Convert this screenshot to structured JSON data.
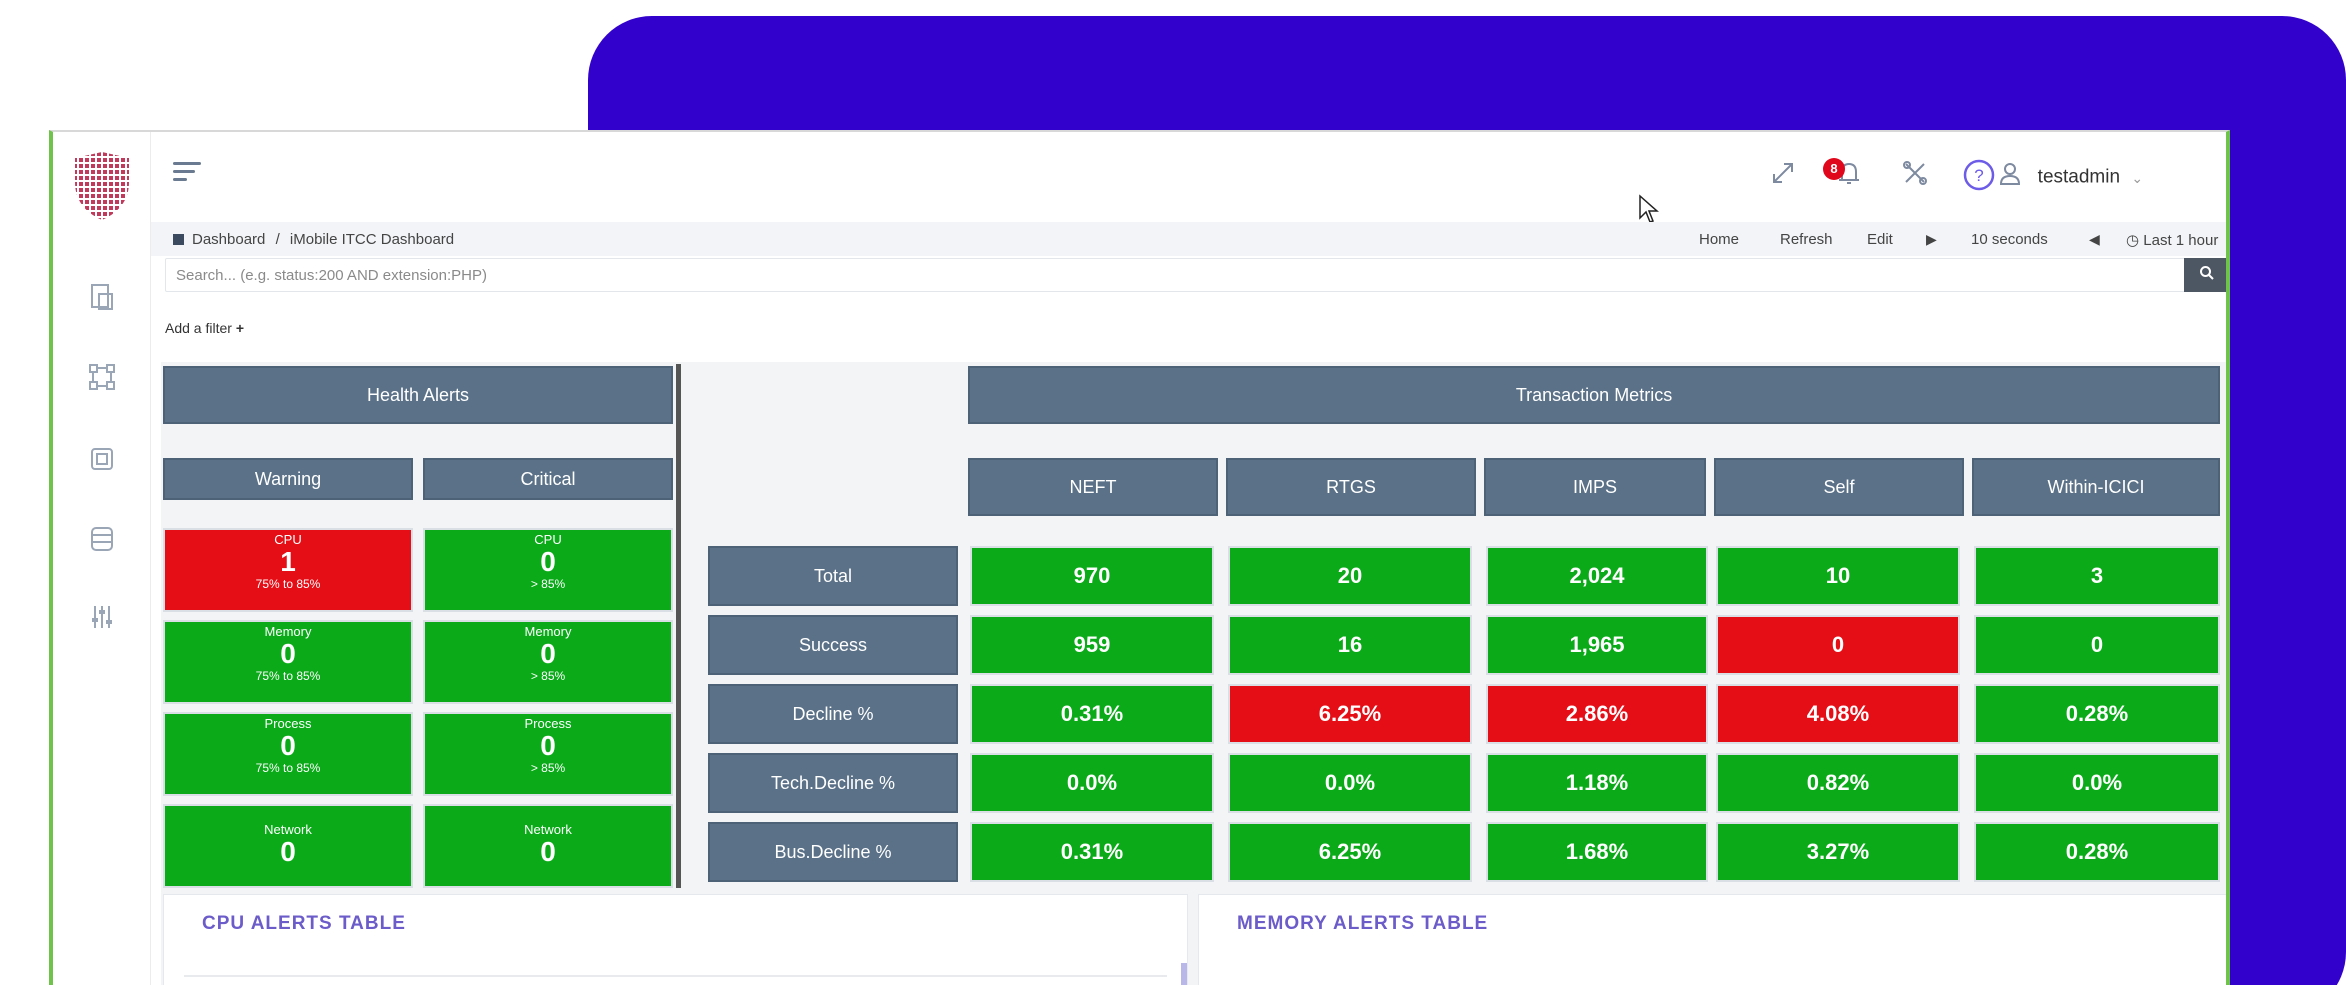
{
  "header": {
    "notification_count": "8",
    "username": "testadmin"
  },
  "toolbar": {
    "breadcrumb_root": "Dashboard",
    "breadcrumb_sep": "/",
    "breadcrumb_current": "iMobile ITCC Dashboard",
    "home": "Home",
    "refresh": "Refresh",
    "edit": "Edit",
    "interval": "10 seconds",
    "time_range": "Last 1 hour"
  },
  "search": {
    "placeholder": "Search... (e.g. status:200 AND extension:PHP)"
  },
  "add_filter": "Add a filter",
  "health": {
    "title": "Health Alerts",
    "warning_label": "Warning",
    "critical_label": "Critical",
    "warning": [
      {
        "label": "CPU",
        "value": "1",
        "range": "75% to 85%",
        "status": "red"
      },
      {
        "label": "Memory",
        "value": "0",
        "range": "75% to 85%",
        "status": "green"
      },
      {
        "label": "Process",
        "value": "0",
        "range": "75% to 85%",
        "status": "green"
      },
      {
        "label": "Network",
        "value": "0",
        "range": "",
        "status": "green"
      }
    ],
    "critical": [
      {
        "label": "CPU",
        "value": "0",
        "range": "> 85%",
        "status": "green"
      },
      {
        "label": "Memory",
        "value": "0",
        "range": "> 85%",
        "status": "green"
      },
      {
        "label": "Process",
        "value": "0",
        "range": "> 85%",
        "status": "green"
      },
      {
        "label": "Network",
        "value": "0",
        "range": "",
        "status": "green"
      }
    ]
  },
  "transactions": {
    "title": "Transaction Metrics",
    "columns": [
      "NEFT",
      "RTGS",
      "IMPS",
      "Self",
      "Within-ICICI"
    ],
    "rows": [
      {
        "label": "Total",
        "values": [
          "970",
          "20",
          "2,024",
          "10",
          "3"
        ],
        "status": [
          "green",
          "green",
          "green",
          "green",
          "green"
        ]
      },
      {
        "label": "Success",
        "values": [
          "959",
          "16",
          "1,965",
          "0",
          "0"
        ],
        "status": [
          "green",
          "green",
          "green",
          "red",
          "green"
        ]
      },
      {
        "label": "Decline %",
        "values": [
          "0.31%",
          "6.25%",
          "2.86%",
          "4.08%",
          "0.28%"
        ],
        "status": [
          "green",
          "red",
          "red",
          "red",
          "green"
        ]
      },
      {
        "label": "Tech.Decline %",
        "values": [
          "0.0%",
          "0.0%",
          "1.18%",
          "0.82%",
          "0.0%"
        ],
        "status": [
          "green",
          "green",
          "green",
          "green",
          "green"
        ]
      },
      {
        "label": "Bus.Decline %",
        "values": [
          "0.31%",
          "6.25%",
          "1.68%",
          "3.27%",
          "0.28%"
        ],
        "status": [
          "green",
          "green",
          "green",
          "green",
          "green"
        ]
      }
    ]
  },
  "cards": {
    "cpu_title": "CPU ALERTS TABLE",
    "memory_title": "MEMORY ALERTS TABLE"
  },
  "colors": {
    "backdrop": "#3201cc",
    "ok": "#0aaa19",
    "alert": "#e60e16",
    "header_cell": "#5a7188"
  },
  "icons": {
    "sidebar": [
      "reports-icon",
      "network-icon",
      "chip-icon",
      "database-icon",
      "sliders-icon"
    ],
    "header": [
      "fullscreen-icon",
      "bell-icon",
      "tools-icon",
      "help-icon",
      "user-icon"
    ]
  }
}
